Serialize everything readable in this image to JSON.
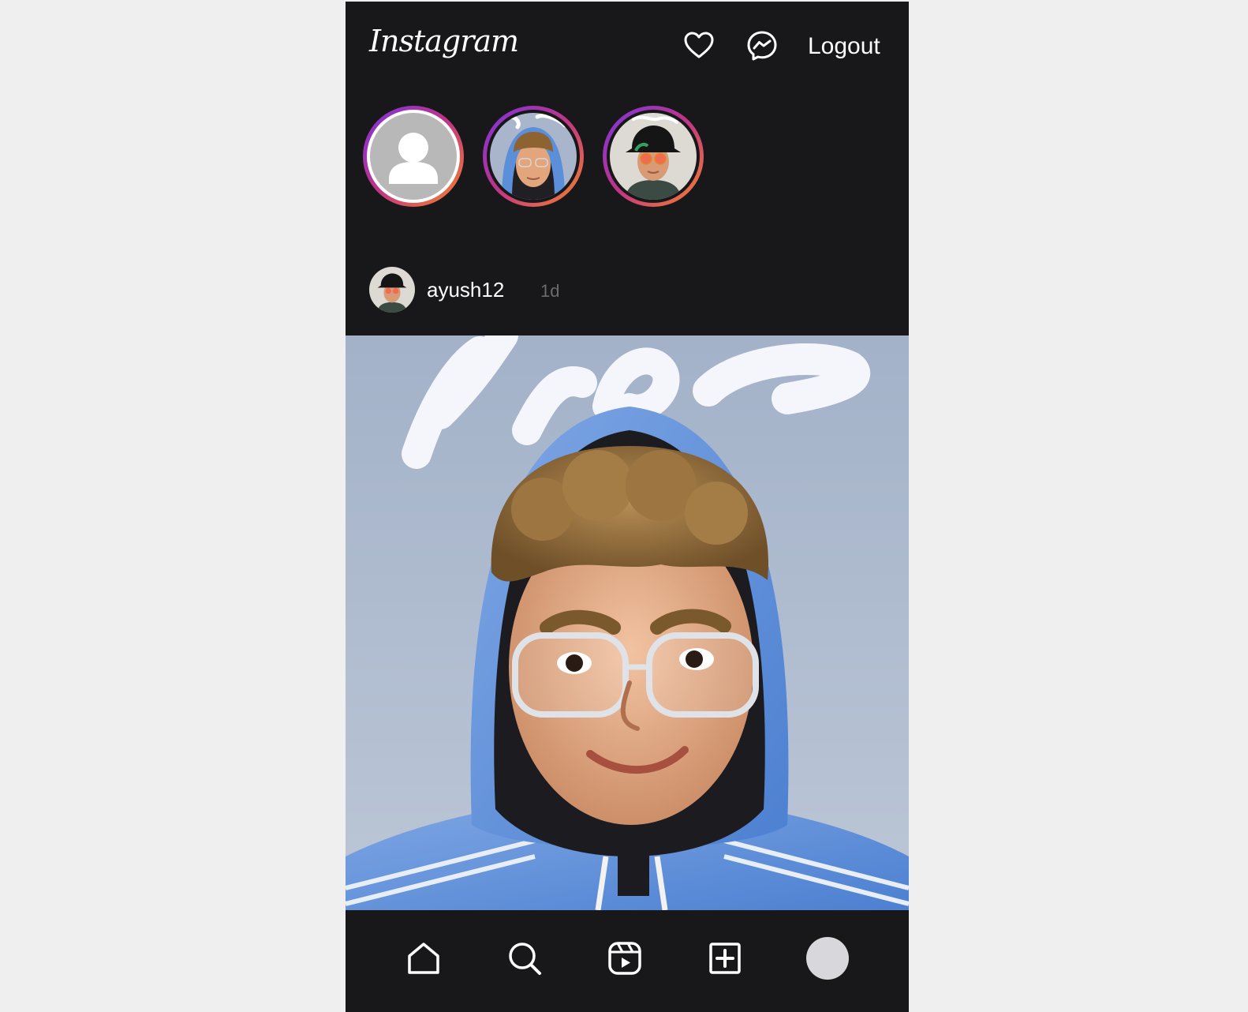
{
  "app": {
    "logo_text": "Instagram",
    "logout_label": "Logout"
  },
  "icons": {
    "notifications": "heart-icon",
    "messages": "messenger-icon",
    "home": "home-icon",
    "search": "search-icon",
    "reels": "reels-icon",
    "create": "create-icon",
    "profile": "avatar"
  },
  "stories": [
    {
      "kind": "default-avatar"
    },
    {
      "kind": "hoodie-avatar"
    },
    {
      "kind": "hat-avatar"
    }
  ],
  "post": {
    "username": "ayush12",
    "time_ago": "1d"
  },
  "colors": {
    "background": "#18181b",
    "page": "#efefef",
    "story_ring_start": "#7a33e0",
    "story_ring_end": "#f58529",
    "muted_text": "#6b6b6f"
  }
}
